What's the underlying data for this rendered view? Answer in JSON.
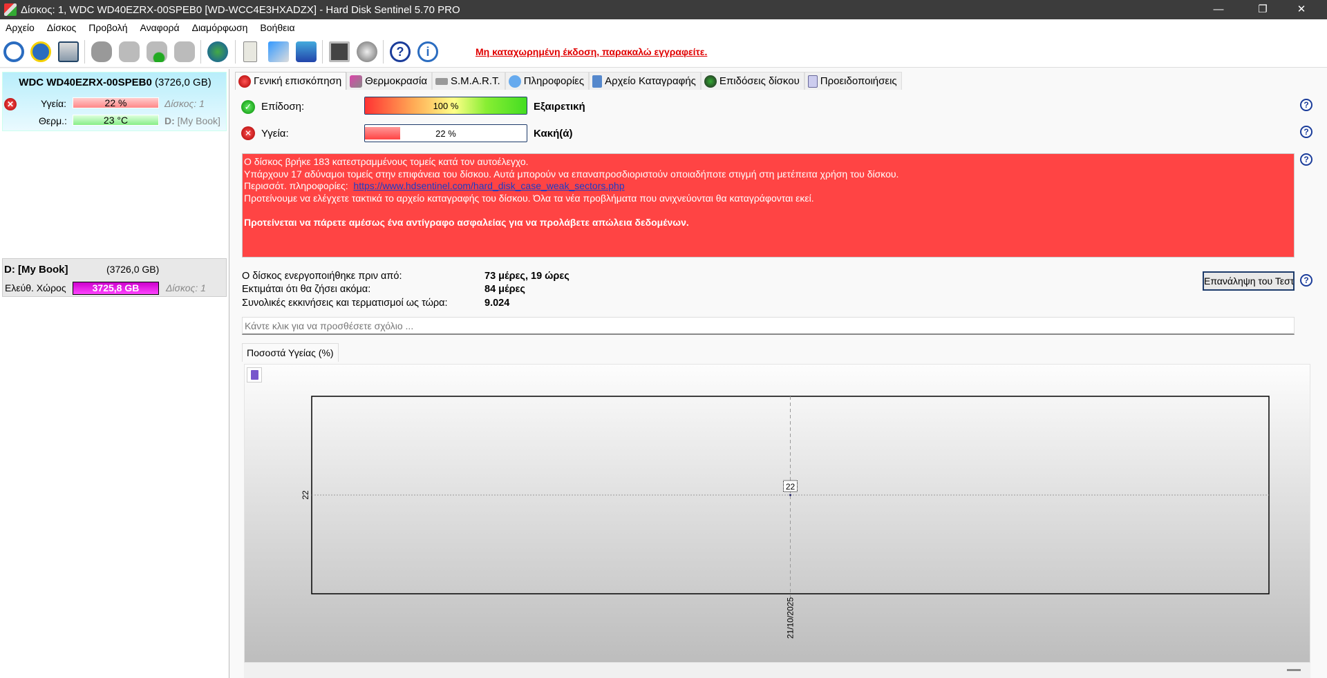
{
  "window": {
    "title": "Δίσκος: 1, WDC WD40EZRX-00SPEB0 [WD-WCC4E3HXADZX]  -  Hard Disk Sentinel 5.70 PRO"
  },
  "menu": [
    "Αρχείο",
    "Δίσκος",
    "Προβολή",
    "Αναφορά",
    "Διαμόρφωση",
    "Βοήθεια"
  ],
  "toolbar": {
    "icons": [
      "refresh-icon",
      "alert-refresh-icon",
      "disk-icon",
      "disk-gray-icon",
      "disk-test-icon",
      "disk-check-icon",
      "disk-search-icon",
      "globe-disk-icon",
      "report-icon",
      "sync-icon",
      "network-icon",
      "monitor-icon",
      "speaker-icon",
      "help-icon",
      "info-icon"
    ],
    "registration": "Μη καταχωρημένη έκδοση, παρακαλώ εγγραφείτε."
  },
  "disk": {
    "name": "WDC WD40EZRX-00SPEB0",
    "size": "(3726,0 GB)",
    "health_label": "Υγεία:",
    "health": "22 %",
    "health_pct": 22,
    "temp_label": "Θερμ.:",
    "temp": "23 °C",
    "disk_no": "Δίσκος: 1",
    "drive_letter": "D:",
    "drive_name": "[My Book]"
  },
  "partition": {
    "name": "D: [My Book]",
    "size": "(3726,0 GB)",
    "free_label": "Ελεύθ. Χώρος",
    "free": "3725,8 GB",
    "disk_no": "Δίσκος: 1"
  },
  "tabs": [
    "Γενική επισκόπηση",
    "Θερμοκρασία",
    "S.M.A.R.T.",
    "Πληροφορίες",
    "Αρχείο Καταγραφής",
    "Επιδόσεις δίσκου",
    "Προειδοποιήσεις"
  ],
  "overview": {
    "performance": {
      "label": "Επίδοση:",
      "value": "100 %",
      "pct": 100,
      "rating": "Εξαιρετική"
    },
    "health": {
      "label": "Υγεία:",
      "value": "22 %",
      "pct": 22,
      "rating": "Κακή(ά)"
    },
    "alert": {
      "line1": "Ο δίσκος βρήκε 183 κατεστραμμένους τομείς κατά τον αυτοέλεγχο.",
      "line2": "Υπάρχουν 17 αδύναμοι τομείς στην επιφάνεια του δίσκου. Αυτά μπορούν να επαναπροσδιοριστούν οποιαδήποτε στιγμή στη μετέπειτα χρήση του δίσκου.",
      "more_label": "Περισσότ. πληροφορίες:",
      "link": "https://www.hdsentinel.com/hard_disk_case_weak_sectors.php",
      "line4": "Προτείνουμε να ελέγχετε τακτικά το αρχείο καταγραφής του δίσκου. Όλα τα νέα προβλήματα που ανιχνεύονται θα καταγράφονται εκεί.",
      "bold": "Προτείνεται να πάρετε αμέσως ένα αντίγραφο ασφαλείας για να προλάβετε απώλεια δεδομένων.",
      "color": "#ff4444"
    },
    "stats": [
      {
        "label": "Ο δίσκος ενεργοποιήθηκε πριν από:",
        "value": "73 μέρες, 19 ώρες"
      },
      {
        "label": "Εκτιμάται ότι θα ζήσει ακόμα:",
        "value": "84 μέρες"
      },
      {
        "label": "Συνολικές εκκινήσεις και τερματισμοί ως τώρα:",
        "value": "9.024"
      }
    ],
    "retest_button": "Επανάληψη του Τεστ",
    "comment_placeholder": "Κάντε κλικ για να προσθέσετε σχόλιο ..."
  },
  "chart_tab": "Ποσοστά Υγείας (%)",
  "chart_data": {
    "type": "line",
    "x": [
      "21/10/2025"
    ],
    "series": [
      {
        "values": [
          22
        ]
      }
    ],
    "ytick_labels": [
      "22"
    ],
    "xtick_labels": [
      "21/10/2025"
    ],
    "data_labels": [
      "22"
    ],
    "grid": true
  }
}
